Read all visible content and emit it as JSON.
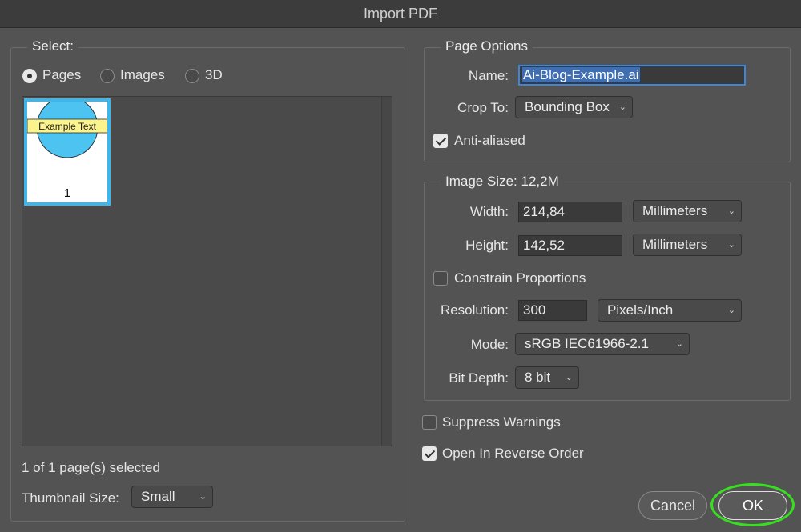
{
  "window": {
    "title": "Import PDF"
  },
  "select": {
    "legend": "Select:",
    "options": [
      {
        "label": "Pages",
        "selected": true
      },
      {
        "label": "Images",
        "selected": false
      },
      {
        "label": "3D",
        "selected": false
      }
    ],
    "thumbnail": {
      "caption_text": "Example Text",
      "page_number": "1"
    },
    "status": "1 of 1 page(s) selected",
    "thumbnail_size_label": "Thumbnail Size:",
    "thumbnail_size_value": "Small"
  },
  "page_options": {
    "legend": "Page Options",
    "name_label": "Name:",
    "name_value": "Ai-Blog-Example.ai",
    "crop_label": "Crop To:",
    "crop_value": "Bounding Box",
    "anti_aliased_label": "Anti-aliased",
    "anti_aliased_checked": true
  },
  "image_size": {
    "legend": "Image Size: 12,2M",
    "width_label": "Width:",
    "width_value": "214,84",
    "width_unit": "Millimeters",
    "height_label": "Height:",
    "height_value": "142,52",
    "height_unit": "Millimeters",
    "constrain_label": "Constrain Proportions",
    "constrain_checked": false,
    "resolution_label": "Resolution:",
    "resolution_value": "300",
    "resolution_unit": "Pixels/Inch",
    "mode_label": "Mode:",
    "mode_value": "sRGB IEC61966-2.1",
    "bitdepth_label": "Bit Depth:",
    "bitdepth_value": "8 bit"
  },
  "options": {
    "suppress_label": "Suppress Warnings",
    "suppress_checked": false,
    "reverse_label": "Open In Reverse Order",
    "reverse_checked": true
  },
  "buttons": {
    "cancel": "Cancel",
    "ok": "OK"
  },
  "colors": {
    "background": "#535353",
    "thumbnail_border": "#3fb6ea",
    "circle_fill": "#4cc3f0",
    "caption_fill": "#fbf38b",
    "focus": "#3d86d8",
    "highlight_ring": "#36e01e"
  }
}
